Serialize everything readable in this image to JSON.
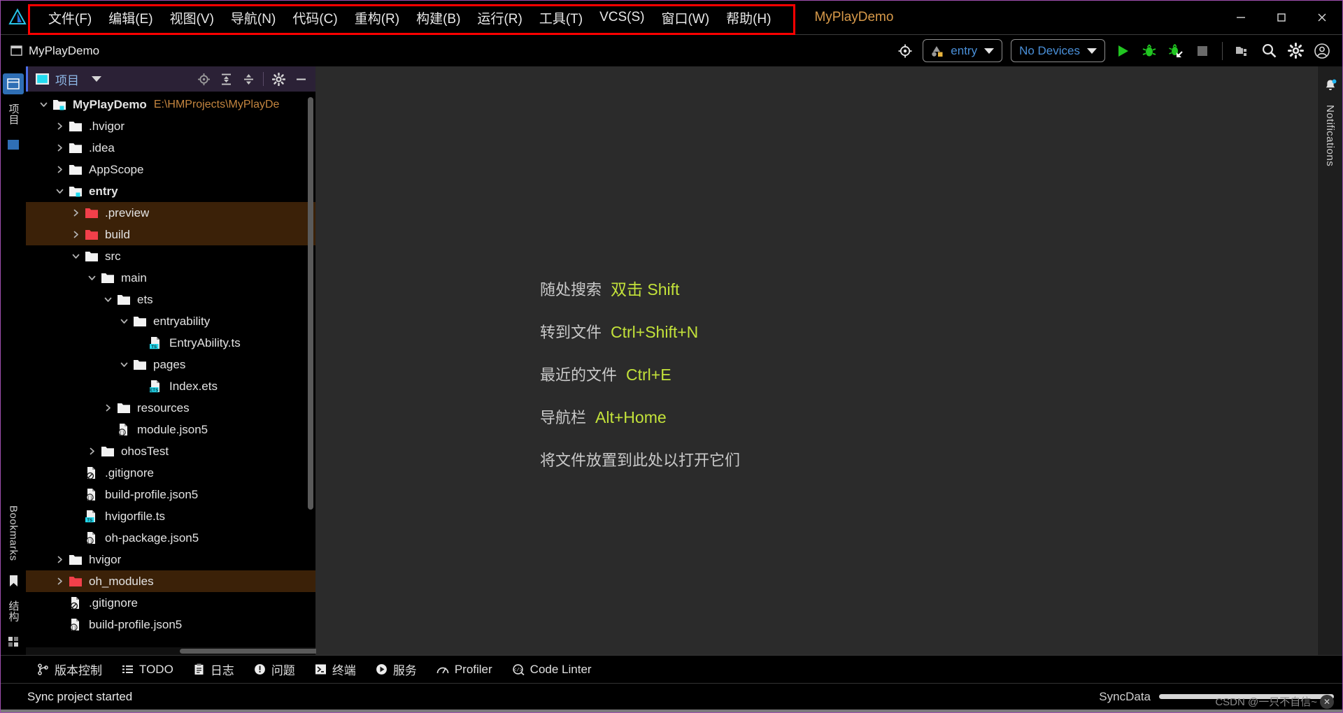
{
  "window": {
    "app_logo": "deveco-logo-icon",
    "project_title": "MyPlayDemo",
    "minimize": "minimize-icon",
    "maximize": "maximize-icon",
    "close": "close-icon"
  },
  "menubar": {
    "items": [
      {
        "label": "文件(F)",
        "name": "menu-file"
      },
      {
        "label": "编辑(E)",
        "name": "menu-edit"
      },
      {
        "label": "视图(V)",
        "name": "menu-view"
      },
      {
        "label": "导航(N)",
        "name": "menu-navigate"
      },
      {
        "label": "代码(C)",
        "name": "menu-code"
      },
      {
        "label": "重构(R)",
        "name": "menu-refactor"
      },
      {
        "label": "构建(B)",
        "name": "menu-build"
      },
      {
        "label": "运行(R)",
        "name": "menu-run"
      },
      {
        "label": "工具(T)",
        "name": "menu-tools"
      },
      {
        "label": "VCS(S)",
        "name": "menu-vcs"
      },
      {
        "label": "窗口(W)",
        "name": "menu-window"
      },
      {
        "label": "帮助(H)",
        "name": "menu-help"
      }
    ]
  },
  "toolbar": {
    "project_name": "MyPlayDemo",
    "project_icon": "project-window-icon",
    "target_device_icon": "device-target-icon",
    "run_config": "entry",
    "device_select": "No Devices",
    "run": "run-icon",
    "debug": "debug-icon",
    "attach_debugger": "attach-debugger-icon",
    "stop": "stop-icon",
    "previewer": "previewer-icon",
    "search": "search-icon",
    "settings": "gear-icon",
    "account": "account-icon"
  },
  "left_rail": {
    "items": [
      {
        "label": "项目",
        "name": "rail-project"
      },
      {
        "label": "Bookmarks",
        "name": "rail-bookmarks"
      },
      {
        "label": "结构",
        "name": "rail-structure"
      }
    ]
  },
  "right_rail": {
    "items": [
      {
        "label": "Notifications",
        "name": "rail-notifications"
      }
    ]
  },
  "project_panel": {
    "title": "项目",
    "title_icon": "project-view-icon",
    "tools": [
      {
        "name": "select-opened-file-icon",
        "label": "scroll-from-source"
      },
      {
        "name": "expand-all-icon",
        "label": "expand-all"
      },
      {
        "name": "collapse-all-icon",
        "label": "collapse-all"
      },
      {
        "name": "gear-icon",
        "label": "options"
      },
      {
        "name": "hide-icon",
        "label": "hide"
      }
    ],
    "tree": [
      {
        "depth": 0,
        "twisty": "down",
        "icon": "module-folder",
        "label": "MyPlayDemo",
        "bold": true,
        "path": "E:\\HMProjects\\MyPlayDe",
        "highlight": false
      },
      {
        "depth": 1,
        "twisty": "right",
        "icon": "folder",
        "label": ".hvigor",
        "bold": false,
        "path": "",
        "highlight": false
      },
      {
        "depth": 1,
        "twisty": "right",
        "icon": "folder",
        "label": ".idea",
        "bold": false,
        "path": "",
        "highlight": false
      },
      {
        "depth": 1,
        "twisty": "right",
        "icon": "folder",
        "label": "AppScope",
        "bold": false,
        "path": "",
        "highlight": false
      },
      {
        "depth": 1,
        "twisty": "down",
        "icon": "module-folder",
        "label": "entry",
        "bold": true,
        "path": "",
        "highlight": false
      },
      {
        "depth": 2,
        "twisty": "right",
        "icon": "folder-red",
        "label": ".preview",
        "bold": false,
        "path": "",
        "highlight": true
      },
      {
        "depth": 2,
        "twisty": "right",
        "icon": "folder-red",
        "label": "build",
        "bold": false,
        "path": "",
        "highlight": true
      },
      {
        "depth": 2,
        "twisty": "down",
        "icon": "folder",
        "label": "src",
        "bold": false,
        "path": "",
        "highlight": false
      },
      {
        "depth": 3,
        "twisty": "down",
        "icon": "folder",
        "label": "main",
        "bold": false,
        "path": "",
        "highlight": false
      },
      {
        "depth": 4,
        "twisty": "down",
        "icon": "folder",
        "label": "ets",
        "bold": false,
        "path": "",
        "highlight": false
      },
      {
        "depth": 5,
        "twisty": "down",
        "icon": "folder",
        "label": "entryability",
        "bold": false,
        "path": "",
        "highlight": false
      },
      {
        "depth": 6,
        "twisty": "none",
        "icon": "file-ts",
        "label": "EntryAbility.ts",
        "bold": false,
        "path": "",
        "highlight": false
      },
      {
        "depth": 5,
        "twisty": "down",
        "icon": "folder",
        "label": "pages",
        "bold": false,
        "path": "",
        "highlight": false
      },
      {
        "depth": 6,
        "twisty": "none",
        "icon": "file-ets",
        "label": "Index.ets",
        "bold": false,
        "path": "",
        "highlight": false
      },
      {
        "depth": 4,
        "twisty": "right",
        "icon": "folder",
        "label": "resources",
        "bold": false,
        "path": "",
        "highlight": false
      },
      {
        "depth": 4,
        "twisty": "none",
        "icon": "file-json5",
        "label": "module.json5",
        "bold": false,
        "path": "",
        "highlight": false
      },
      {
        "depth": 3,
        "twisty": "right",
        "icon": "folder",
        "label": "ohosTest",
        "bold": false,
        "path": "",
        "highlight": false
      },
      {
        "depth": 2,
        "twisty": "none",
        "icon": "file-gitignore",
        "label": ".gitignore",
        "bold": false,
        "path": "",
        "highlight": false
      },
      {
        "depth": 2,
        "twisty": "none",
        "icon": "file-json5",
        "label": "build-profile.json5",
        "bold": false,
        "path": "",
        "highlight": false
      },
      {
        "depth": 2,
        "twisty": "none",
        "icon": "file-ts",
        "label": "hvigorfile.ts",
        "bold": false,
        "path": "",
        "highlight": false
      },
      {
        "depth": 2,
        "twisty": "none",
        "icon": "file-json5",
        "label": "oh-package.json5",
        "bold": false,
        "path": "",
        "highlight": false
      },
      {
        "depth": 1,
        "twisty": "right",
        "icon": "folder",
        "label": "hvigor",
        "bold": false,
        "path": "",
        "highlight": false
      },
      {
        "depth": 1,
        "twisty": "right",
        "icon": "folder-red",
        "label": "oh_modules",
        "bold": false,
        "path": "",
        "highlight": true
      },
      {
        "depth": 1,
        "twisty": "none",
        "icon": "file-gitignore",
        "label": ".gitignore",
        "bold": false,
        "path": "",
        "highlight": false
      },
      {
        "depth": 1,
        "twisty": "none",
        "icon": "file-json5",
        "label": "build-profile.json5",
        "bold": false,
        "path": "",
        "highlight": false
      }
    ]
  },
  "editor": {
    "shortcuts": [
      {
        "label": "随处搜索",
        "keys": "双击 Shift"
      },
      {
        "label": "转到文件",
        "keys": "Ctrl+Shift+N"
      },
      {
        "label": "最近的文件",
        "keys": "Ctrl+E"
      },
      {
        "label": "导航栏",
        "keys": "Alt+Home"
      }
    ],
    "drop_hint": "将文件放置到此处以打开它们"
  },
  "bottom_bar": {
    "items": [
      {
        "label": "版本控制",
        "icon": "vcs-branch-icon",
        "name": "tool-version-control"
      },
      {
        "label": "TODO",
        "icon": "todo-list-icon",
        "name": "tool-todo"
      },
      {
        "label": "日志",
        "icon": "log-icon",
        "name": "tool-log"
      },
      {
        "label": "问题",
        "icon": "problems-icon",
        "name": "tool-problems"
      },
      {
        "label": "终端",
        "icon": "terminal-icon",
        "name": "tool-terminal"
      },
      {
        "label": "服务",
        "icon": "services-icon",
        "name": "tool-services"
      },
      {
        "label": "Profiler",
        "icon": "profiler-icon",
        "name": "tool-profiler"
      },
      {
        "label": "Code Linter",
        "icon": "code-linter-icon",
        "name": "tool-code-linter"
      }
    ]
  },
  "status_bar": {
    "message": "Sync project started",
    "sync_label": "SyncData",
    "progress_percent": 0,
    "watermark": "CSDN @一只不自信~"
  },
  "colors": {
    "accent_orange": "#d89a4a",
    "key_green": "#c3e23a",
    "highlight_brown": "#3b2108",
    "panel_header": "#2b2136",
    "editor_bg": "#2b2b2b",
    "run_green": "#21c521",
    "red_box": "#ff0000",
    "window_border": "#a04fb0"
  }
}
